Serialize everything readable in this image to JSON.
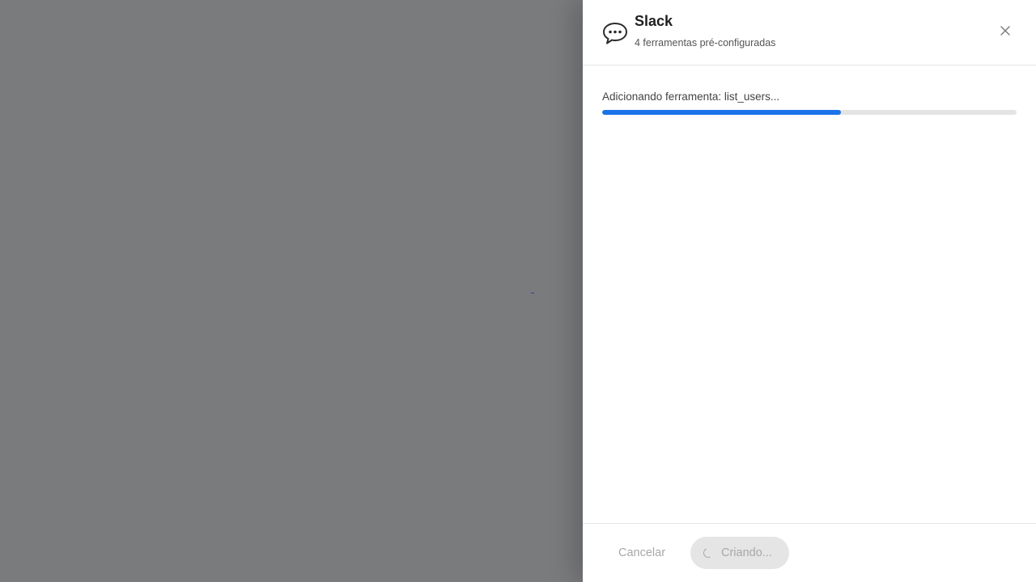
{
  "modal": {
    "app_name": "Slack",
    "subtitle": "4 ferramentas pré-configuradas",
    "icon": "speech-bubble-icon",
    "close_icon": "close-icon"
  },
  "progress": {
    "label": "Adicionando ferramenta: list_users...",
    "fraction": 0.576,
    "color": "#1a73e8"
  },
  "footer": {
    "cancel_label": "Cancelar",
    "create_label": "Criando..."
  }
}
